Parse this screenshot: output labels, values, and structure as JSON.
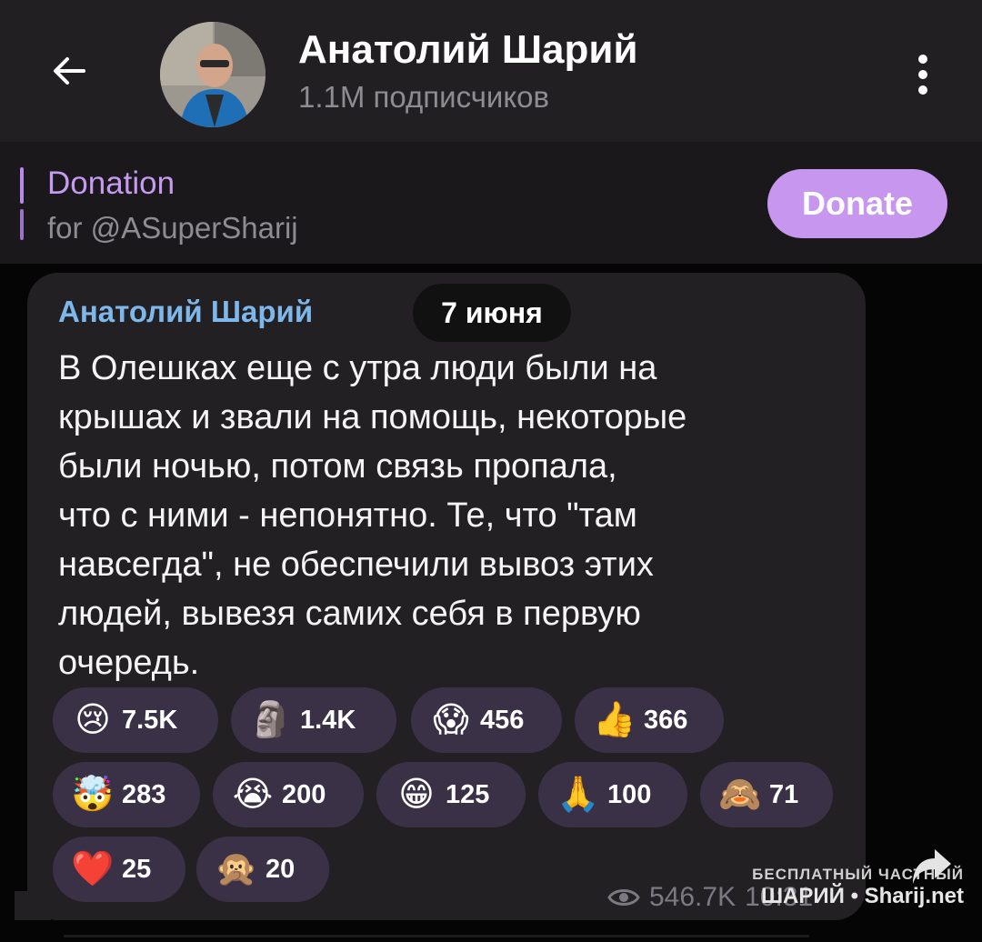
{
  "header": {
    "title": "Анатолий Шарий",
    "subtitle": "1.1M подписчиков"
  },
  "pinned": {
    "title": "Donation",
    "text": "for @ASuperSharij",
    "button": "Donate"
  },
  "message": {
    "author": "Анатолий Шарий",
    "date": "7 июня",
    "lines": [
      "В Олешках еще с утра люди были на",
      "крышах и звали на помощь, некоторые",
      "были ночью, потом связь пропала,",
      "что с ними - непонятно. Те, что \"там",
      "навсегда\", не обеспечили вывоз этих",
      "людей, вывезя самих себя в первую",
      "очередь."
    ],
    "reactions": [
      {
        "emoji": "😢",
        "count": "7.5K"
      },
      {
        "emoji": "🗿",
        "count": "1.4K"
      },
      {
        "emoji": "😱",
        "count": "456"
      },
      {
        "emoji": "👍",
        "count": "366"
      },
      {
        "emoji": "🤯",
        "count": "283"
      },
      {
        "emoji": "😭",
        "count": "200"
      },
      {
        "emoji": "😁",
        "count": "125"
      },
      {
        "emoji": "🙏",
        "count": "100"
      },
      {
        "emoji": "🙈",
        "count": "71"
      },
      {
        "emoji": "❤️",
        "count": "25"
      },
      {
        "emoji": "🙊",
        "count": "20"
      }
    ],
    "views": "546.7K",
    "time": "10:31"
  },
  "watermark": {
    "line1": "БЕСПЛАТНЫЙ ЧАСТНЫЙ",
    "line2": "ШАРИЙ • Sharij.net"
  },
  "icons": {
    "back": "back-arrow-icon",
    "menu": "more-vertical-icon",
    "views": "eye-icon",
    "share": "share-icon"
  },
  "colors": {
    "header_bg": "#221f22",
    "accent": "#c796ef",
    "author": "#7eb7ea",
    "bubble": "#222023",
    "reaction_bg": "#3a3146"
  }
}
